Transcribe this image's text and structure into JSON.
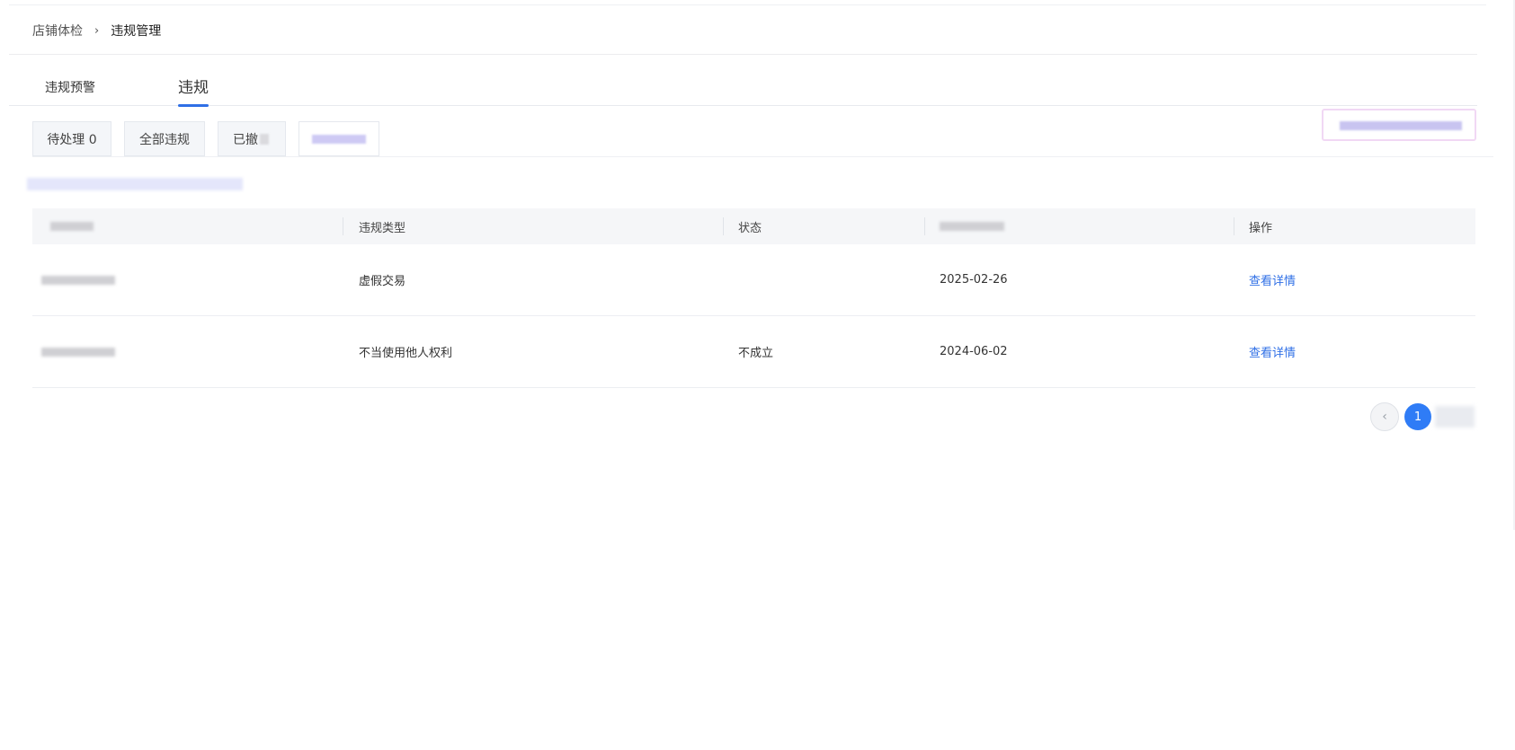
{
  "breadcrumb": {
    "parent": "店铺体检",
    "separator": "›",
    "current": "违规管理"
  },
  "main_tabs": [
    {
      "label": "违规预警",
      "active": false
    },
    {
      "label": "违规",
      "active": true
    }
  ],
  "filters": [
    {
      "label": "待处理 0"
    },
    {
      "label": "全部违规"
    },
    {
      "label": "已撤"
    },
    {
      "label": ""
    }
  ],
  "table": {
    "headers": [
      "",
      "违规类型",
      "状态",
      "",
      "操作"
    ],
    "rows": [
      {
        "type": "虚假交易",
        "status": "",
        "date": "2025-02-26",
        "action": "查看详情"
      },
      {
        "type": "不当使用他人权利",
        "status": "不成立",
        "date": "2024-06-02",
        "action": "查看详情"
      }
    ]
  },
  "pagination": {
    "prev_icon": "chevron-left-icon",
    "prev_glyph": "‹",
    "current_page": "1"
  },
  "colors": {
    "accent": "#2f6fe6",
    "page_active": "#2f7cf6"
  }
}
